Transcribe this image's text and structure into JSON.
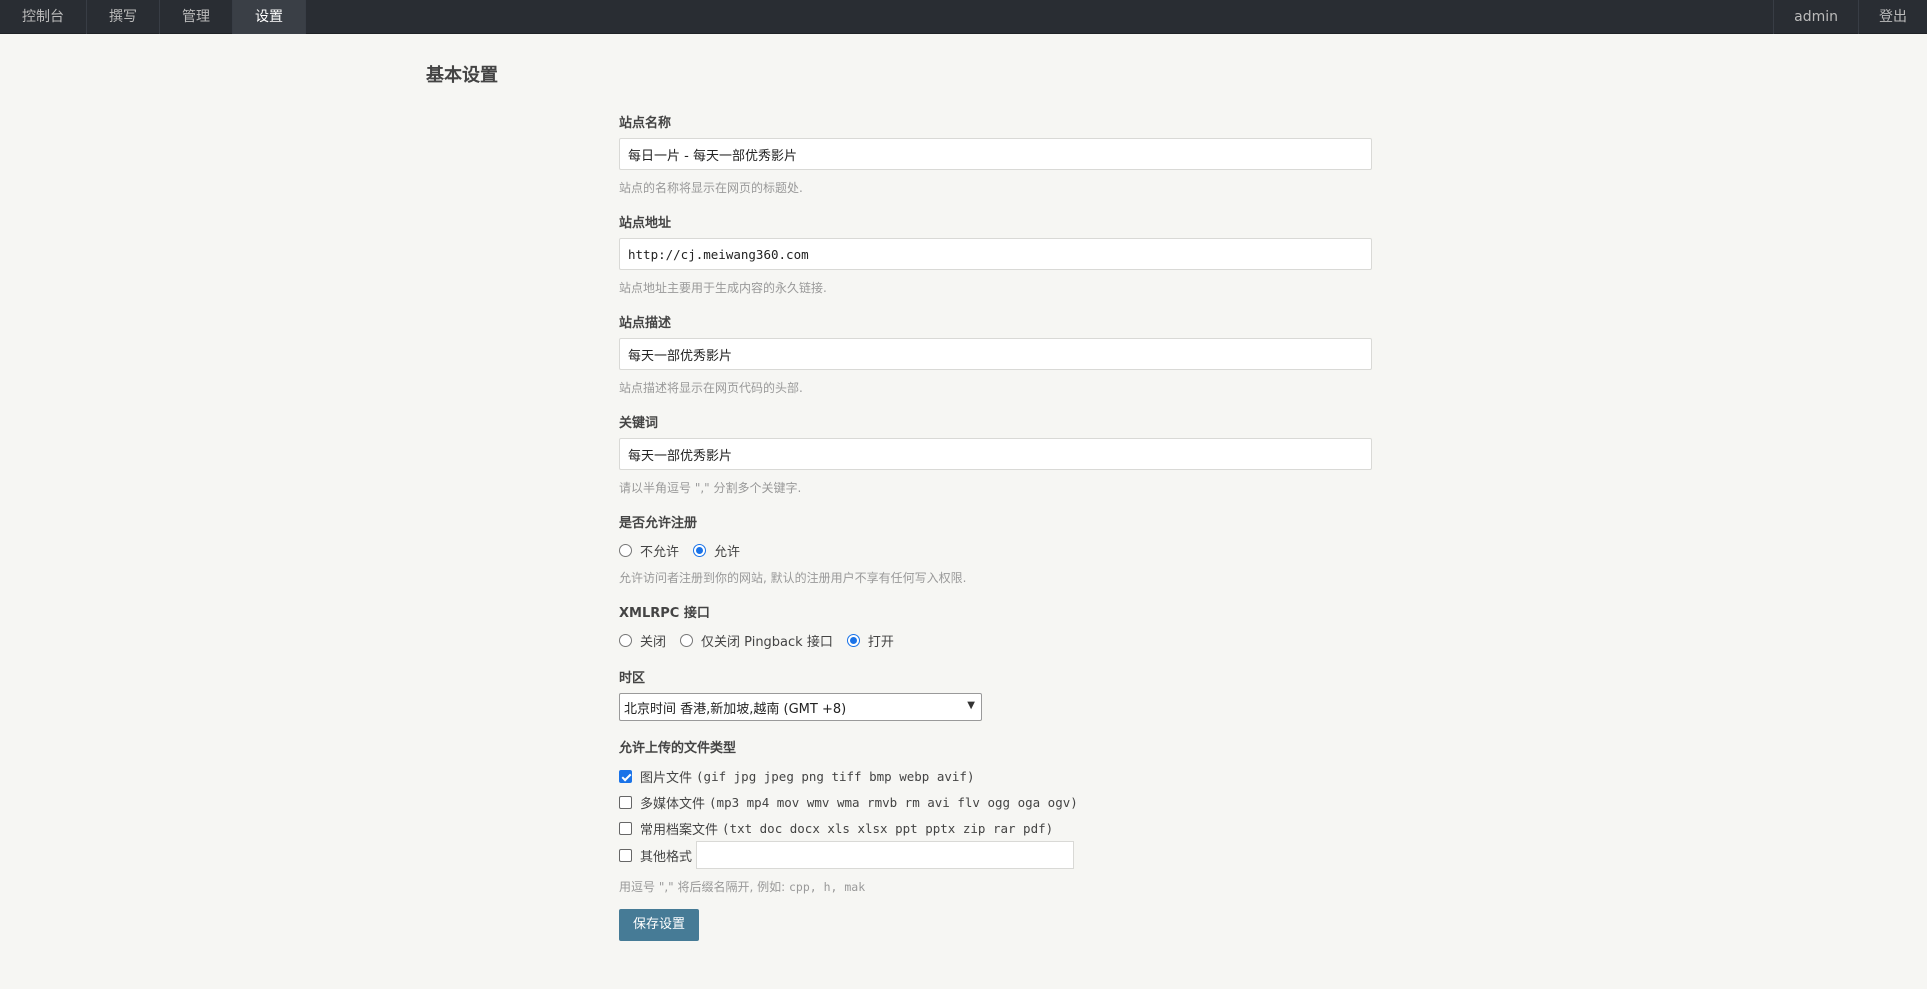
{
  "nav": {
    "left": [
      "控制台",
      "撰写",
      "管理",
      "设置"
    ],
    "active": "设置",
    "user": "admin",
    "logout": "登出"
  },
  "page": {
    "title": "基本设置"
  },
  "fields": {
    "site_name": {
      "label": "站点名称",
      "value": "每日一片 - 每天一部优秀影片",
      "desc": "站点的名称将显示在网页的标题处."
    },
    "site_url": {
      "label": "站点地址",
      "value": "http://cj.meiwang360.com",
      "desc": "站点地址主要用于生成内容的永久链接."
    },
    "site_desc": {
      "label": "站点描述",
      "value": "每天一部优秀影片",
      "desc": "站点描述将显示在网页代码的头部."
    },
    "keywords": {
      "label": "关键词",
      "value": "每天一部优秀影片",
      "desc": "请以半角逗号 \",\" 分割多个关键字."
    }
  },
  "register": {
    "label": "是否允许注册",
    "options": [
      "不允许",
      "允许"
    ],
    "selected": "允许",
    "desc": "允许访问者注册到你的网站, 默认的注册用户不享有任何写入权限."
  },
  "xmlrpc": {
    "label": "XMLRPC 接口",
    "options": [
      "关闭",
      "仅关闭 Pingback 接口",
      "打开"
    ],
    "selected": "打开"
  },
  "timezone": {
    "label": "时区",
    "selected": "北京时间 香港,新加坡,越南 (GMT +8)"
  },
  "upload": {
    "label": "允许上传的文件类型",
    "options": [
      {
        "name": "图片文件",
        "exts": "(gif jpg jpeg png tiff bmp webp avif)",
        "checked": true
      },
      {
        "name": "多媒体文件",
        "exts": "(mp3 mp4 mov wmv wma rmvb rm avi flv ogg oga ogv)",
        "checked": false
      },
      {
        "name": "常用档案文件",
        "exts": "(txt doc docx xls xlsx ppt pptx zip rar pdf)",
        "checked": false
      }
    ],
    "other_label": "其他格式",
    "other_value": "",
    "desc_prefix": "用逗号 \",\" 将后缀名隔开, 例如: ",
    "desc_example": "cpp, h, mak"
  },
  "save_label": "保存设置",
  "colors": {
    "topbar": "#292d33",
    "button": "#467b96",
    "radio_accent": "#1a73e8",
    "background": "#f6f6f3"
  }
}
